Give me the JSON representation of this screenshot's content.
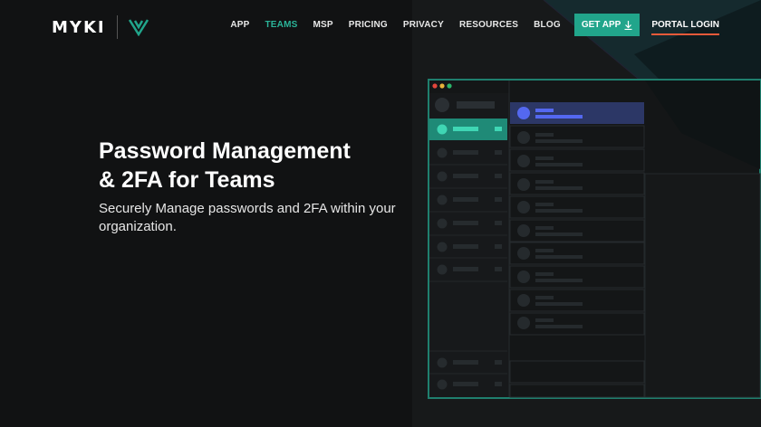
{
  "brand": {
    "name": "MYKI",
    "accent": "#21a58b",
    "underline": "#e85a3a"
  },
  "nav": {
    "items": [
      {
        "label": "APP",
        "active": false
      },
      {
        "label": "TEAMS",
        "active": true
      },
      {
        "label": "MSP",
        "active": false
      },
      {
        "label": "PRICING",
        "active": false
      },
      {
        "label": "PRIVACY",
        "active": false
      },
      {
        "label": "RESOURCES",
        "active": false
      },
      {
        "label": "BLOG",
        "active": false
      }
    ],
    "get_app": "GET APP",
    "portal_login": "PORTAL LOGIN"
  },
  "hero": {
    "title_line1": "Password Management",
    "title_line2": "& 2FA for Teams",
    "subtitle": "Securely Manage passwords and 2FA within your organization."
  }
}
